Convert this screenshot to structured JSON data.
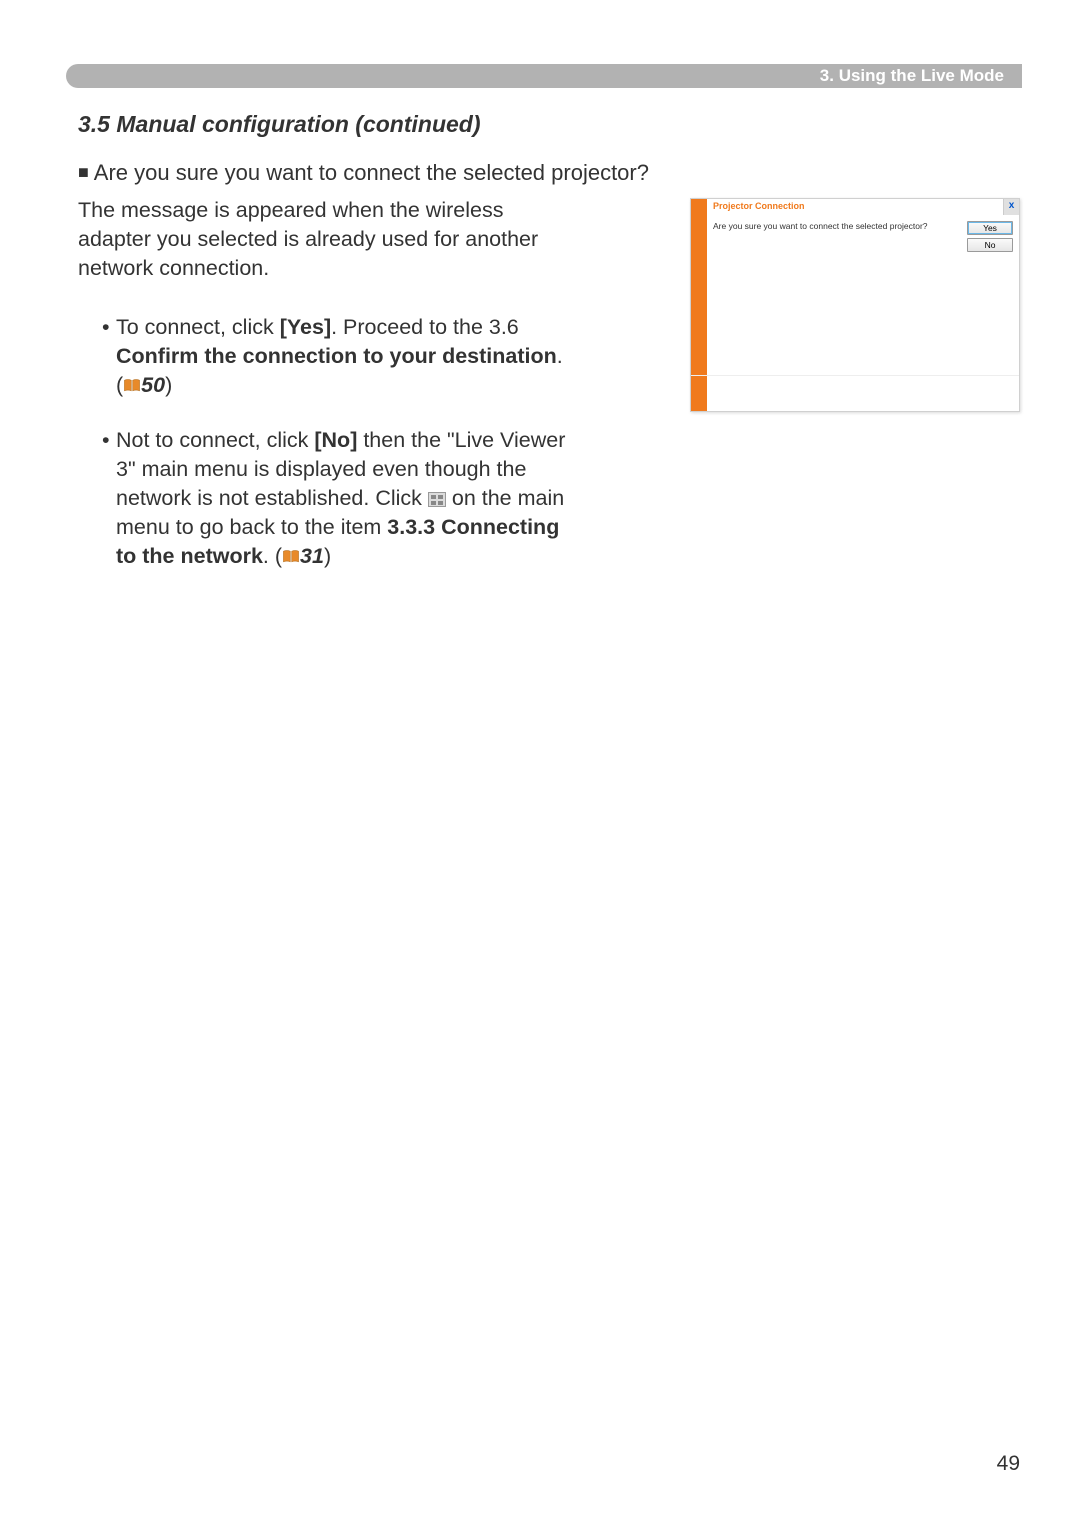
{
  "header": {
    "chapter": "3. Using the Live Mode"
  },
  "section": {
    "title": "3.5 Manual configuration (continued)"
  },
  "content": {
    "bullet_marker": "■",
    "question": " Are you sure you want to connect the selected projector?",
    "intro": "The message is appeared when the wireless adapter you you selected is already used for another network connection.",
    "item1": {
      "dot": "•",
      "pre": " To connect, click ",
      "yes_bold": "[Yes]",
      "mid": ". Proceed to the 3.6 ",
      "confirm_bold": "Confirm the connection to your destination",
      "post1": ". (",
      "ref": "50",
      "post2": ")"
    },
    "item2": {
      "dot": "•",
      "pre": " Not to connect, click ",
      "no_bold": "[No]",
      "mid1": " then the \"Live Viewer 3\" main menu is displayed even though the network is not established. Click ",
      "mid2": " on the main menu to go back to the item ",
      "connecting_bold": "3.3.3 Connecting to the network",
      "post1": ". (",
      "ref": "31",
      "post2": ")"
    }
  },
  "dialog": {
    "title": "Projector Connection",
    "close": "x",
    "question": "Are you sure you want to connect the selected projector?",
    "yes": "Yes",
    "no": "No"
  },
  "page_number": "49"
}
